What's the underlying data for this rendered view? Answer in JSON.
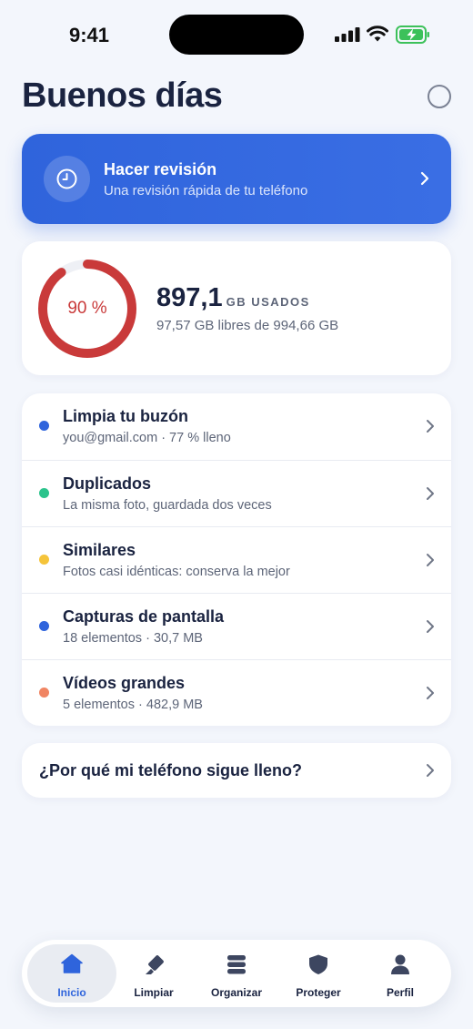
{
  "status": {
    "time": "9:41"
  },
  "greeting": "Buenos días",
  "review": {
    "title": "Hacer revisión",
    "subtitle": "Una revisión rápida de tu teléfono"
  },
  "storage": {
    "percent_used": 90,
    "percent_label": "90 %",
    "used_value": "897,1",
    "used_unit": "GB USADOS",
    "free_text": "97,57 GB libres de 994,66 GB",
    "ring_color": "#c93a3a"
  },
  "items": [
    {
      "title": "Limpia tu buzón",
      "subtitle": "you@gmail.com · 77 % lleno",
      "dot_color": "#2f64dc"
    },
    {
      "title": "Duplicados",
      "subtitle": "La misma foto, guardada dos veces",
      "dot_color": "#2bc38c"
    },
    {
      "title": "Similares",
      "subtitle": "Fotos casi idénticas: conserva la mejor",
      "dot_color": "#f5c43a"
    },
    {
      "title": "Capturas de pantalla",
      "subtitle": "18 elementos · 30,7 MB",
      "dot_color": "#2f64dc"
    },
    {
      "title": "Vídeos grandes",
      "subtitle": "5 elementos · 482,9 MB",
      "dot_color": "#f08563"
    }
  ],
  "why": "¿Por qué mi teléfono sigue lleno?",
  "tabs": [
    {
      "label": "Inicio",
      "icon": "home-icon",
      "active": true
    },
    {
      "label": "Limpiar",
      "icon": "eraser-icon",
      "active": false
    },
    {
      "label": "Organizar",
      "icon": "stack-icon",
      "active": false
    },
    {
      "label": "Proteger",
      "icon": "shield-icon",
      "active": false
    },
    {
      "label": "Perfil",
      "icon": "person-icon",
      "active": false
    }
  ],
  "colors": {
    "accent": "#2f64dc",
    "background": "#f3f6fc"
  }
}
